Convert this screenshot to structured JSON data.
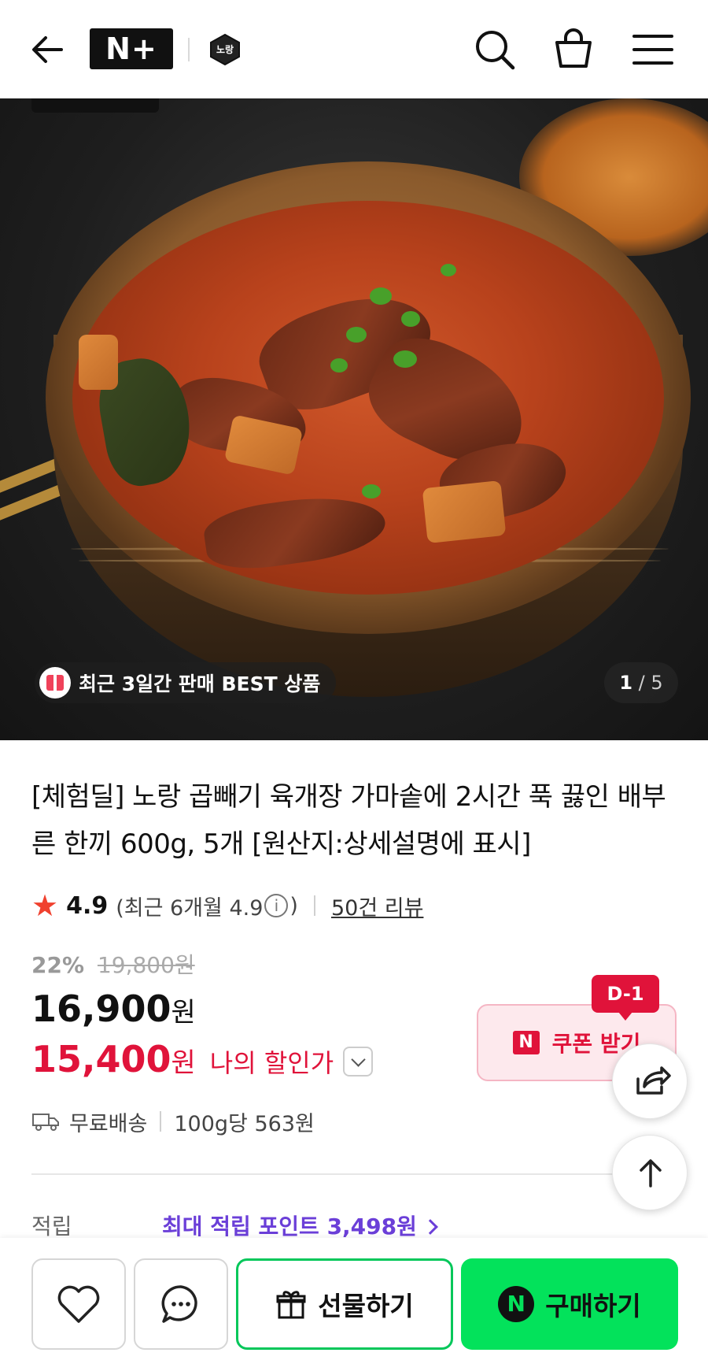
{
  "header": {
    "logo_text": "N+",
    "brand_logo_text": "노랑"
  },
  "hero": {
    "badge_text": "최근 3일간 판매 BEST 상품",
    "pager_current": "1",
    "pager_separator": " / ",
    "pager_total": "5"
  },
  "product": {
    "title": "[체험딜] 노랑 곱빼기 육개장 가마솥에 2시간 푹 끓인 배부른 한끼 600g, 5개 [원산지:상세설명에 표시]",
    "rating": {
      "star": "★",
      "score": "4.9",
      "recent_prefix": "(최근 6개월 4.9",
      "info": "i",
      "recent_suffix": ")",
      "reviews": "50건 리뷰"
    },
    "discount_percent": "22%",
    "original_price": "19,800원",
    "price": "16,900",
    "price_unit": "원",
    "my_price": "15,400",
    "my_price_unit": "원",
    "my_price_label": "나의 할인가",
    "coupon": {
      "badge": "D-1",
      "mark": "N",
      "label": "쿠폰 받기"
    },
    "shipping": "무료배송",
    "unit_price": "100g당 563원",
    "points": {
      "label": "적립",
      "value": "최대 적립 포인트 3,498원"
    }
  },
  "bottom_bar": {
    "gift_label": "선물하기",
    "buy_mark": "N",
    "buy_label": "구매하기"
  },
  "colors": {
    "discount_red": "#e0133a",
    "naver_green": "#03e25b",
    "points_purple": "#6b3fd8"
  },
  "icons": [
    "back-arrow-icon",
    "search-icon",
    "shopping-bag-icon",
    "menu-icon",
    "gift-icon",
    "info-icon",
    "truck-icon",
    "share-icon",
    "arrow-up-icon",
    "heart-icon",
    "chat-icon"
  ]
}
